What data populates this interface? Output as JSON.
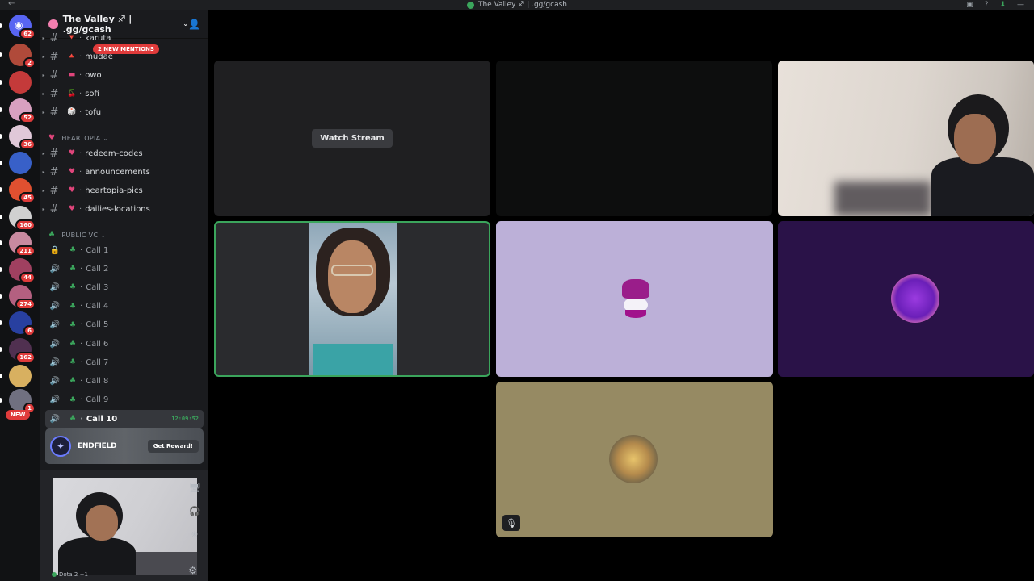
{
  "window": {
    "title": "The Valley ♐ | .gg/gcash"
  },
  "servers": {
    "items": [
      {
        "name": "discord-home",
        "badge": "62",
        "color": "#5865f2"
      },
      {
        "name": "server-2",
        "badge": "2",
        "color": "#b04a3a"
      },
      {
        "name": "server-3",
        "badge": "",
        "color": "#c43a3a"
      },
      {
        "name": "server-4",
        "badge": "52",
        "color": "#d8a0c0"
      },
      {
        "name": "server-5",
        "badge": "36",
        "color": "#e0c8d8"
      },
      {
        "name": "server-6",
        "badge": "",
        "color": "#3860c8"
      },
      {
        "name": "server-7",
        "badge": "45",
        "color": "#e05030"
      },
      {
        "name": "server-8",
        "badge": "160",
        "color": "#d0d0d0"
      },
      {
        "name": "server-9",
        "badge": "211",
        "color": "#c88aa0"
      },
      {
        "name": "server-10",
        "badge": "44",
        "color": "#a04060"
      },
      {
        "name": "server-11",
        "badge": "274",
        "color": "#b46080"
      },
      {
        "name": "server-12",
        "badge": "6",
        "color": "#2840a0"
      },
      {
        "name": "server-13",
        "badge": "162",
        "color": "#503050"
      },
      {
        "name": "server-14",
        "badge": "",
        "color": "#d8b060"
      },
      {
        "name": "server-15",
        "badge": "1",
        "color": "#707080"
      }
    ],
    "new_label": "NEW"
  },
  "sidebar": {
    "server_name": "The Valley ♐ | .gg/gcash",
    "new_mentions": "2 NEW MENTIONS",
    "channels_top": [
      {
        "emoji": "🔻",
        "name": "karuta"
      },
      {
        "emoji": "🔺",
        "name": "mudae"
      },
      {
        "emoji": "▬",
        "name": "owo"
      },
      {
        "emoji": "🍒",
        "name": "sofi"
      },
      {
        "emoji": "🎲",
        "name": "tofu"
      }
    ],
    "category_heartopia": "HEARTOPIA",
    "channels_heartopia": [
      {
        "emoji": "♥",
        "name": "redeem-codes"
      },
      {
        "emoji": "♥",
        "name": "announcements"
      },
      {
        "emoji": "♥",
        "name": "heartopia-pics"
      },
      {
        "emoji": "♥",
        "name": "dailies-locations"
      }
    ],
    "category_vc": "PUBLIC VC",
    "voice_channels": [
      "Call 1",
      "Call 2",
      "Call 3",
      "Call 4",
      "Call 5",
      "Call 6",
      "Call 7",
      "Call 8",
      "Call 9"
    ],
    "active_call": {
      "name": "Call 10",
      "timer": "12:09:52"
    },
    "promo": {
      "name": "ENDFIELD",
      "button": "Get Reward!"
    },
    "user_status": "Dota 2 +1"
  },
  "stage": {
    "watch_stream": "Watch Stream"
  },
  "icons": {
    "hash": "#",
    "speaker": "🔊",
    "lock": "🔒",
    "clover": "♣"
  },
  "colors": {
    "accent_green": "#3ba55c",
    "badge_red": "#e03b3b"
  }
}
